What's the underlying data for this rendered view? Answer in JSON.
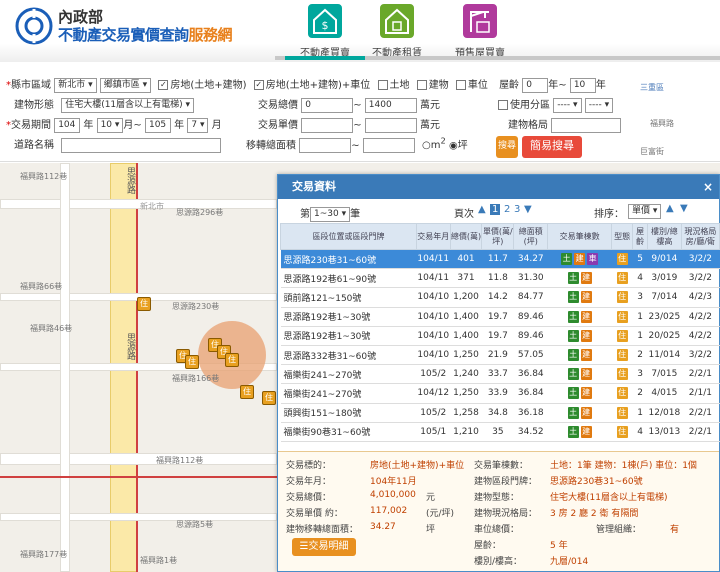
{
  "header": {
    "ministry": "內政部",
    "title_main": "不動產交易實價查詢",
    "title_accent": "服務網",
    "nav": [
      {
        "label": "不動產買賣",
        "icon": "dollar-house-icon",
        "color": "#00a79d"
      },
      {
        "label": "不動產租賃",
        "icon": "rent-house-icon",
        "color": "#6aa82a"
      },
      {
        "label": "預售屋買賣",
        "icon": "crane-icon",
        "color": "#b03a9c"
      }
    ]
  },
  "form": {
    "region_label": "縣市區域",
    "city": "新北市",
    "district": "鄉鎮市區",
    "types": [
      {
        "label": "房地(土地+建物)",
        "checked": true
      },
      {
        "label": "房地(土地+建物)+車位",
        "checked": true
      },
      {
        "label": "土地",
        "checked": false
      },
      {
        "label": "建物",
        "checked": false
      },
      {
        "label": "車位",
        "checked": false
      }
    ],
    "age_label": "屋齡",
    "age_from": "0",
    "age_sep": "年~",
    "age_to": "10",
    "age_unit": "年",
    "building_type_label": "建物形態",
    "building_type": "住宅大樓(11層含以上有電梯)",
    "total_price_label": "交易總價",
    "total_from": "0",
    "tilde": "~",
    "total_to": "1400",
    "wan_unit": "萬元",
    "zoning_label": "使用分區",
    "zoning_a": "----",
    "zoning_b": "----",
    "period_label": "交易期間",
    "year_from": "104",
    "year_unit": "年",
    "month_from": "10",
    "month_unit_to": "月~",
    "year_to": "105",
    "month_to": "7",
    "month_unit": "月",
    "unit_price_label": "交易單價",
    "unit_wan": "萬元",
    "layout_label": "建物格局",
    "road_label": "道路名稱",
    "area_label": "移轉總面積",
    "m2_label": "m",
    "ping_label": "坪",
    "search_label": "搜尋",
    "simple_search_label": "簡易搜尋"
  },
  "map": {
    "roads": [
      "福興路112巷",
      "思源路",
      "思源路296巷",
      "思源路230巷",
      "福興路66巷",
      "福興路46巷",
      "福興路166巷",
      "新北市",
      "福興路112巷",
      "思源路",
      "思源路5巷",
      "福興路177巷",
      "福興路1巷",
      "三重區",
      "福興路",
      "巨富街"
    ],
    "pin_label": "住",
    "cluster_color": "#e8a070"
  },
  "panel": {
    "title": "交易資料",
    "close": "×",
    "page_prefix": "第",
    "page_range": "1~30",
    "page_suffix": "筆",
    "pages_label": "頁次",
    "pages": [
      "1",
      "2",
      "3"
    ],
    "sort_label": "排序：",
    "sort_value": "單價",
    "columns": [
      "區段位置或區段門牌",
      "交易年月",
      "總價(萬)",
      "單價(萬/坪)",
      "總面積(坪)",
      "交易筆棟數",
      "型態",
      "屋齡",
      "樓別/總樓高",
      "現況格局房/廳/衛"
    ],
    "tag_labels": {
      "land": "土",
      "building": "建",
      "car": "車",
      "res": "住"
    },
    "rows": [
      {
        "loc": "思源路230巷31~60號",
        "ym": "104/11",
        "total": "401",
        "unit": "11.7",
        "area": "34.27",
        "car": true,
        "age": "5",
        "floor": "9/014",
        "layout": "3/2/2"
      },
      {
        "loc": "思源路192巷61~90號",
        "ym": "104/11",
        "total": "371",
        "unit": "11.8",
        "area": "31.30",
        "car": false,
        "age": "4",
        "floor": "3/019",
        "layout": "3/2/2"
      },
      {
        "loc": "頭前路121~150號",
        "ym": "104/10",
        "total": "1,200",
        "unit": "14.2",
        "area": "84.77",
        "car": false,
        "age": "3",
        "floor": "7/014",
        "layout": "4/2/3"
      },
      {
        "loc": "思源路192巷1~30號",
        "ym": "104/10",
        "total": "1,400",
        "unit": "19.7",
        "area": "89.46",
        "car": false,
        "age": "1",
        "floor": "23/025",
        "layout": "4/2/2"
      },
      {
        "loc": "思源路192巷1~30號",
        "ym": "104/10",
        "total": "1,400",
        "unit": "19.7",
        "area": "89.46",
        "car": false,
        "age": "1",
        "floor": "20/025",
        "layout": "4/2/2"
      },
      {
        "loc": "思源路332巷31~60號",
        "ym": "104/10",
        "total": "1,250",
        "unit": "21.9",
        "area": "57.05",
        "car": false,
        "age": "2",
        "floor": "11/014",
        "layout": "3/2/2"
      },
      {
        "loc": "福樂街241~270號",
        "ym": "105/2",
        "total": "1,240",
        "unit": "33.7",
        "area": "36.84",
        "car": false,
        "age": "3",
        "floor": "7/015",
        "layout": "2/2/1"
      },
      {
        "loc": "福樂街241~270號",
        "ym": "104/12",
        "total": "1,250",
        "unit": "33.9",
        "area": "36.84",
        "car": false,
        "age": "2",
        "floor": "4/015",
        "layout": "2/1/1"
      },
      {
        "loc": "頭興街151~180號",
        "ym": "105/2",
        "total": "1,258",
        "unit": "34.8",
        "area": "36.18",
        "car": false,
        "age": "1",
        "floor": "12/018",
        "layout": "2/2/1"
      },
      {
        "loc": "福樂街90巷31~60號",
        "ym": "105/1",
        "total": "1,210",
        "unit": "35",
        "area": "34.52",
        "car": false,
        "age": "4",
        "floor": "13/013",
        "layout": "2/2/1"
      }
    ],
    "detail": {
      "type_label": "交易標的：",
      "type_val": "房地(土地+建物)+車位",
      "count_label": "交易筆棟數：",
      "count_val": "土地：1筆 建物：1棟(戶) 車位：1個",
      "ym_label": "交易年月：",
      "ym_val": "104年11月",
      "addr_label": "建物區段門牌：",
      "addr_val": "思源路230巷31~60號",
      "total_label": "交易總價：",
      "total_val": "4,010,000",
      "total_unit": "元",
      "form_label": "建物型態：",
      "form_val": "住宅大樓(11層含以上有電梯)",
      "unit_label": "交易單價 約：",
      "unit_val": "117,002",
      "unit_unit": "(元/坪)",
      "layout_label": "建物現況格局：",
      "layout_val": "3 房 2 廳 2 衛 有隔間",
      "area_label": "建物移轉總面積：",
      "area_val": "34.27",
      "area_unit": "坪",
      "park_label": "車位總價：",
      "mgmt_label": "管理組織：",
      "mgmt_val": "有",
      "age_label": "屋齡：",
      "age_val": "5 年",
      "floor_label": "樓別/樓高：",
      "floor_val": "九層/014",
      "detail_btn": "交易明細"
    }
  }
}
